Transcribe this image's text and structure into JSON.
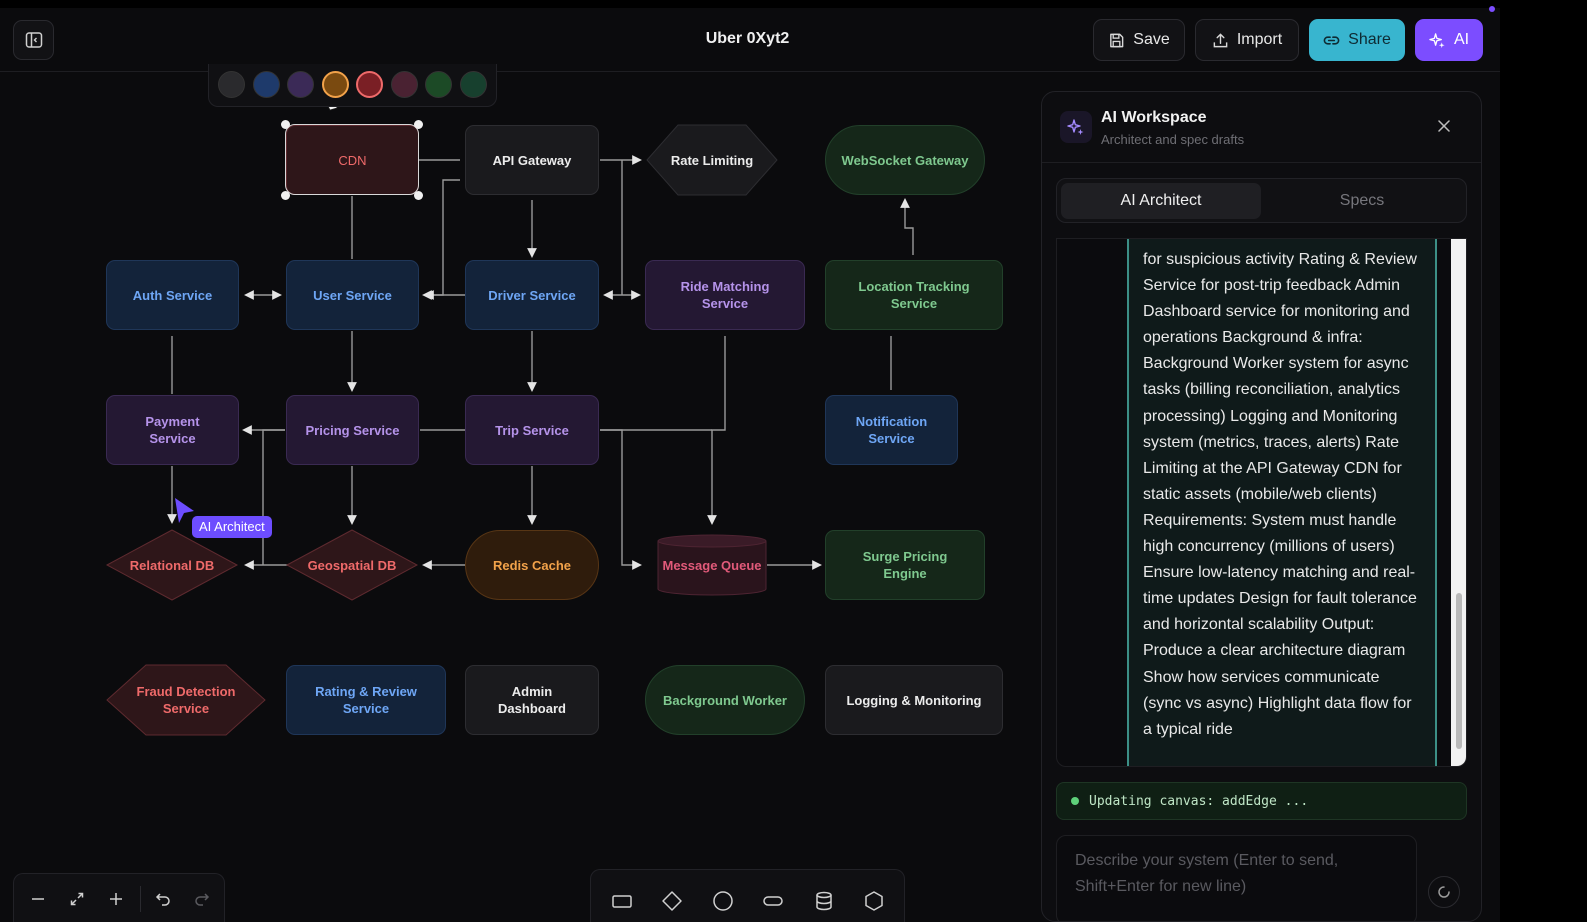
{
  "header": {
    "title": "Uber 0Xyt2",
    "save_label": "Save",
    "import_label": "Import",
    "share_label": "Share",
    "ai_label": "AI"
  },
  "colors": {
    "accent": "#7c4dff",
    "share": "#38b5cf",
    "palette": [
      "#2a2a2d",
      "#1e3a6b",
      "#3b2a57",
      "#7a4a10",
      "#7a1f25",
      "#4a2232",
      "#1c4a26",
      "#17402e"
    ]
  },
  "nodes": {
    "cdn": "CDN",
    "api_gateway": "API Gateway",
    "rate_limiting": "Rate Limiting",
    "websocket_gateway": "WebSocket Gateway",
    "auth_service": "Auth Service",
    "user_service": "User Service",
    "driver_service": "Driver Service",
    "ride_matching_service": "Ride Matching Service",
    "location_tracking_service": "Location Tracking Service",
    "payment_service": "Payment Service",
    "pricing_service": "Pricing Service",
    "trip_service": "Trip Service",
    "notification_service": "Notification Service",
    "relational_db": "Relational DB",
    "geospatial_db": "Geospatial DB",
    "redis_cache": "Redis Cache",
    "message_queue": "Message Queue",
    "surge_pricing_engine": "Surge Pricing Engine",
    "fraud_detection_service": "Fraud Detection Service",
    "rating_review_service": "Rating & Review Service",
    "admin_dashboard": "Admin Dashboard",
    "background_worker": "Background Worker",
    "logging_monitoring": "Logging & Monitoring"
  },
  "cursor": {
    "label": "AI Architect"
  },
  "panel": {
    "title": "AI Workspace",
    "subtitle": "Architect and spec drafts",
    "tabs": [
      "AI Architect",
      "Specs"
    ],
    "message": "for suspicious activity Rating & Review Service for post-trip feedback Admin Dashboard service for monitoring and operations Background & infra: Background Worker system for async tasks (billing reconciliation, analytics processing) Logging and Monitoring system (metrics, traces, alerts) Rate Limiting at the API Gateway CDN for static assets (mobile/web clients) Requirements: System must handle high concurrency (millions of users) Ensure low-latency matching and real-time updates Design for fault tolerance and horizontal scalability Output: Produce a clear architecture diagram Show how services communicate (sync vs async) Highlight data flow for a typical ride",
    "status": "Updating canvas: addEdge ...",
    "input_placeholder": "Describe your system (Enter to send, Shift+Enter for new line)"
  },
  "toolbars": {
    "zoom": [
      "zoom-out",
      "fit-view",
      "zoom-in",
      "undo",
      "redo"
    ],
    "shapes": [
      "rectangle",
      "diamond",
      "circle",
      "pill",
      "database",
      "hexagon"
    ]
  }
}
